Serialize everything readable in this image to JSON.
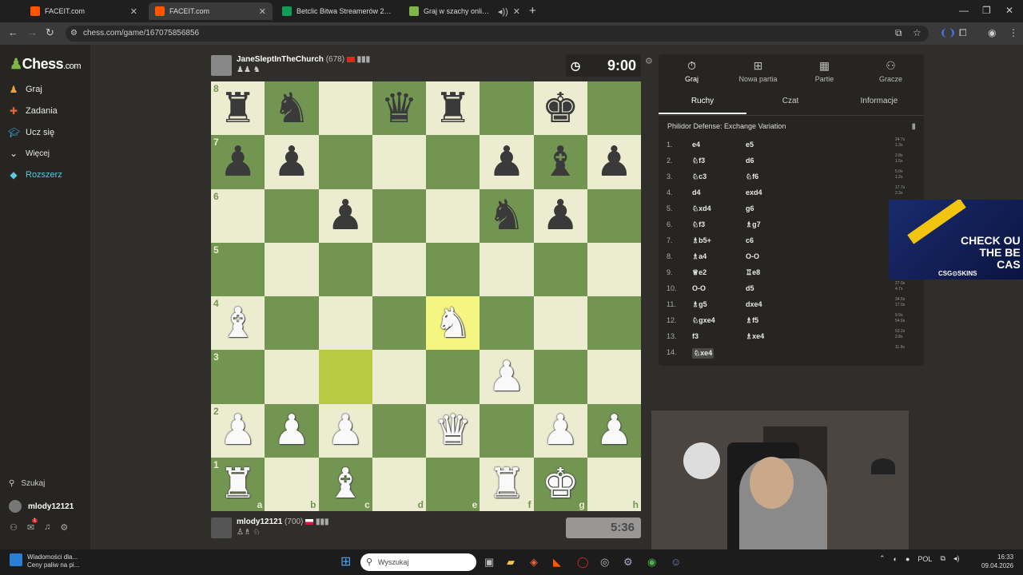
{
  "browser": {
    "tabs": [
      {
        "title": "FACEIT.com",
        "color": "#ff5500"
      },
      {
        "title": "FACEIT.com",
        "color": "#ff5500"
      },
      {
        "title": "Betclic Bitwa Streamerów 2 - A",
        "color": "#0f9d58"
      },
      {
        "title": "Graj w szachy online ZA DA",
        "color": "#81b64c"
      }
    ],
    "url": "chess.com/game/167075856856"
  },
  "sidebar": {
    "logo": "Chess",
    "logo_suffix": ".com",
    "items": [
      {
        "label": "Graj",
        "icon": "play-icon"
      },
      {
        "label": "Zadania",
        "icon": "puzzle-icon"
      },
      {
        "label": "Ucz się",
        "icon": "learn-icon"
      },
      {
        "label": "Więcej",
        "icon": "chevron-down-icon"
      },
      {
        "label": "Rozszerz",
        "icon": "diamond-icon"
      }
    ],
    "search_label": "Szukaj",
    "username": "mlody12121",
    "notification_count": "1"
  },
  "top_player": {
    "name": "JaneSleptInTheChurch",
    "rating": "(678)",
    "captured": "♟♟ ♞",
    "clock": "9:00"
  },
  "bottom_player": {
    "name": "mlody12121",
    "rating": "(700)",
    "captured": "♙♗ ♘",
    "clock": "5:36"
  },
  "board": {
    "rows": [
      [
        "r",
        "n",
        "",
        "q",
        "r",
        "",
        "k",
        ""
      ],
      [
        "p",
        "p",
        "",
        "",
        "",
        "p",
        "b",
        "p"
      ],
      [
        "",
        "",
        "p",
        "",
        "",
        "n",
        "p",
        ""
      ],
      [
        "",
        "",
        "",
        "",
        "",
        "",
        "",
        ""
      ],
      [
        "B",
        "",
        "",
        "",
        "N",
        "",
        "",
        ""
      ],
      [
        "",
        "",
        "",
        "",
        "",
        "P",
        "",
        ""
      ],
      [
        "P",
        "P",
        "P",
        "",
        "Q",
        "",
        "P",
        "P"
      ],
      [
        "R",
        "",
        "B",
        "",
        "",
        "R",
        "K",
        ""
      ]
    ],
    "files": [
      "a",
      "b",
      "c",
      "d",
      "e",
      "f",
      "g",
      "h"
    ],
    "ranks": [
      "8",
      "7",
      "6",
      "5",
      "4",
      "3",
      "2",
      "1"
    ],
    "highlights": [
      "c3",
      "e4"
    ],
    "light_color": "#ebecd0",
    "dark_color": "#739552"
  },
  "panel": {
    "tabs": [
      {
        "label": "Graj",
        "icon": "clock-icon"
      },
      {
        "label": "Nowa partia",
        "icon": "plus-icon"
      },
      {
        "label": "Partie",
        "icon": "board-icon"
      },
      {
        "label": "Gracze",
        "icon": "players-icon"
      }
    ],
    "subtabs": [
      "Ruchy",
      "Czat",
      "Informacje"
    ],
    "opening": "Philidor Defense: Exchange Variation",
    "moves": [
      {
        "n": "1.",
        "w": "e4",
        "b": "e5"
      },
      {
        "n": "2.",
        "w": "♘f3",
        "b": "d6"
      },
      {
        "n": "3.",
        "w": "♘c3",
        "b": "♘f6"
      },
      {
        "n": "4.",
        "w": "d4",
        "b": "exd4"
      },
      {
        "n": "5.",
        "w": "♘xd4",
        "b": "g6"
      },
      {
        "n": "6.",
        "w": "♘f3",
        "b": "♗g7"
      },
      {
        "n": "7.",
        "w": "♗b5+",
        "b": "c6"
      },
      {
        "n": "8.",
        "w": "♗a4",
        "b": "O-O"
      },
      {
        "n": "9.",
        "w": "♕e2",
        "b": "♖e8"
      },
      {
        "n": "10.",
        "w": "O-O",
        "b": "d5"
      },
      {
        "n": "11.",
        "w": "♗g5",
        "b": "dxe4"
      },
      {
        "n": "12.",
        "w": "♘gxe4",
        "b": "♗f5"
      },
      {
        "n": "13.",
        "w": "f3",
        "b": "♗xe4"
      },
      {
        "n": "14.",
        "w": "♘xe4",
        "b": ""
      }
    ],
    "times": [
      [
        "24.7s",
        "1.3s"
      ],
      [
        "2.8s",
        "1.5s"
      ],
      [
        "5.0s",
        "1.2s"
      ],
      [
        "17.7s",
        "2.3s"
      ],
      [
        "1.8s",
        "4.0s"
      ],
      [
        "3.3s",
        ""
      ],
      [
        "",
        ""
      ],
      [
        "",
        ""
      ],
      [
        "",
        ""
      ],
      [
        "27.0s",
        "4.7s"
      ],
      [
        "34.5s",
        "17.0s"
      ],
      [
        "9.9s",
        "54.6s"
      ],
      [
        "53.2s",
        "2.8s"
      ],
      [
        "11.9s",
        ""
      ]
    ]
  },
  "ad": {
    "line1": "CHECK OU",
    "line2": "THE BE",
    "line3": "CAS",
    "brand": "CSG⊙SKINS"
  },
  "taskbar": {
    "news_line1": "Wiadomości dla...",
    "news_line2": "Ceny paliw na pi...",
    "search_placeholder": "Wyszukaj",
    "lang": "POL",
    "time": "16:33",
    "date": "09.04.2026"
  }
}
